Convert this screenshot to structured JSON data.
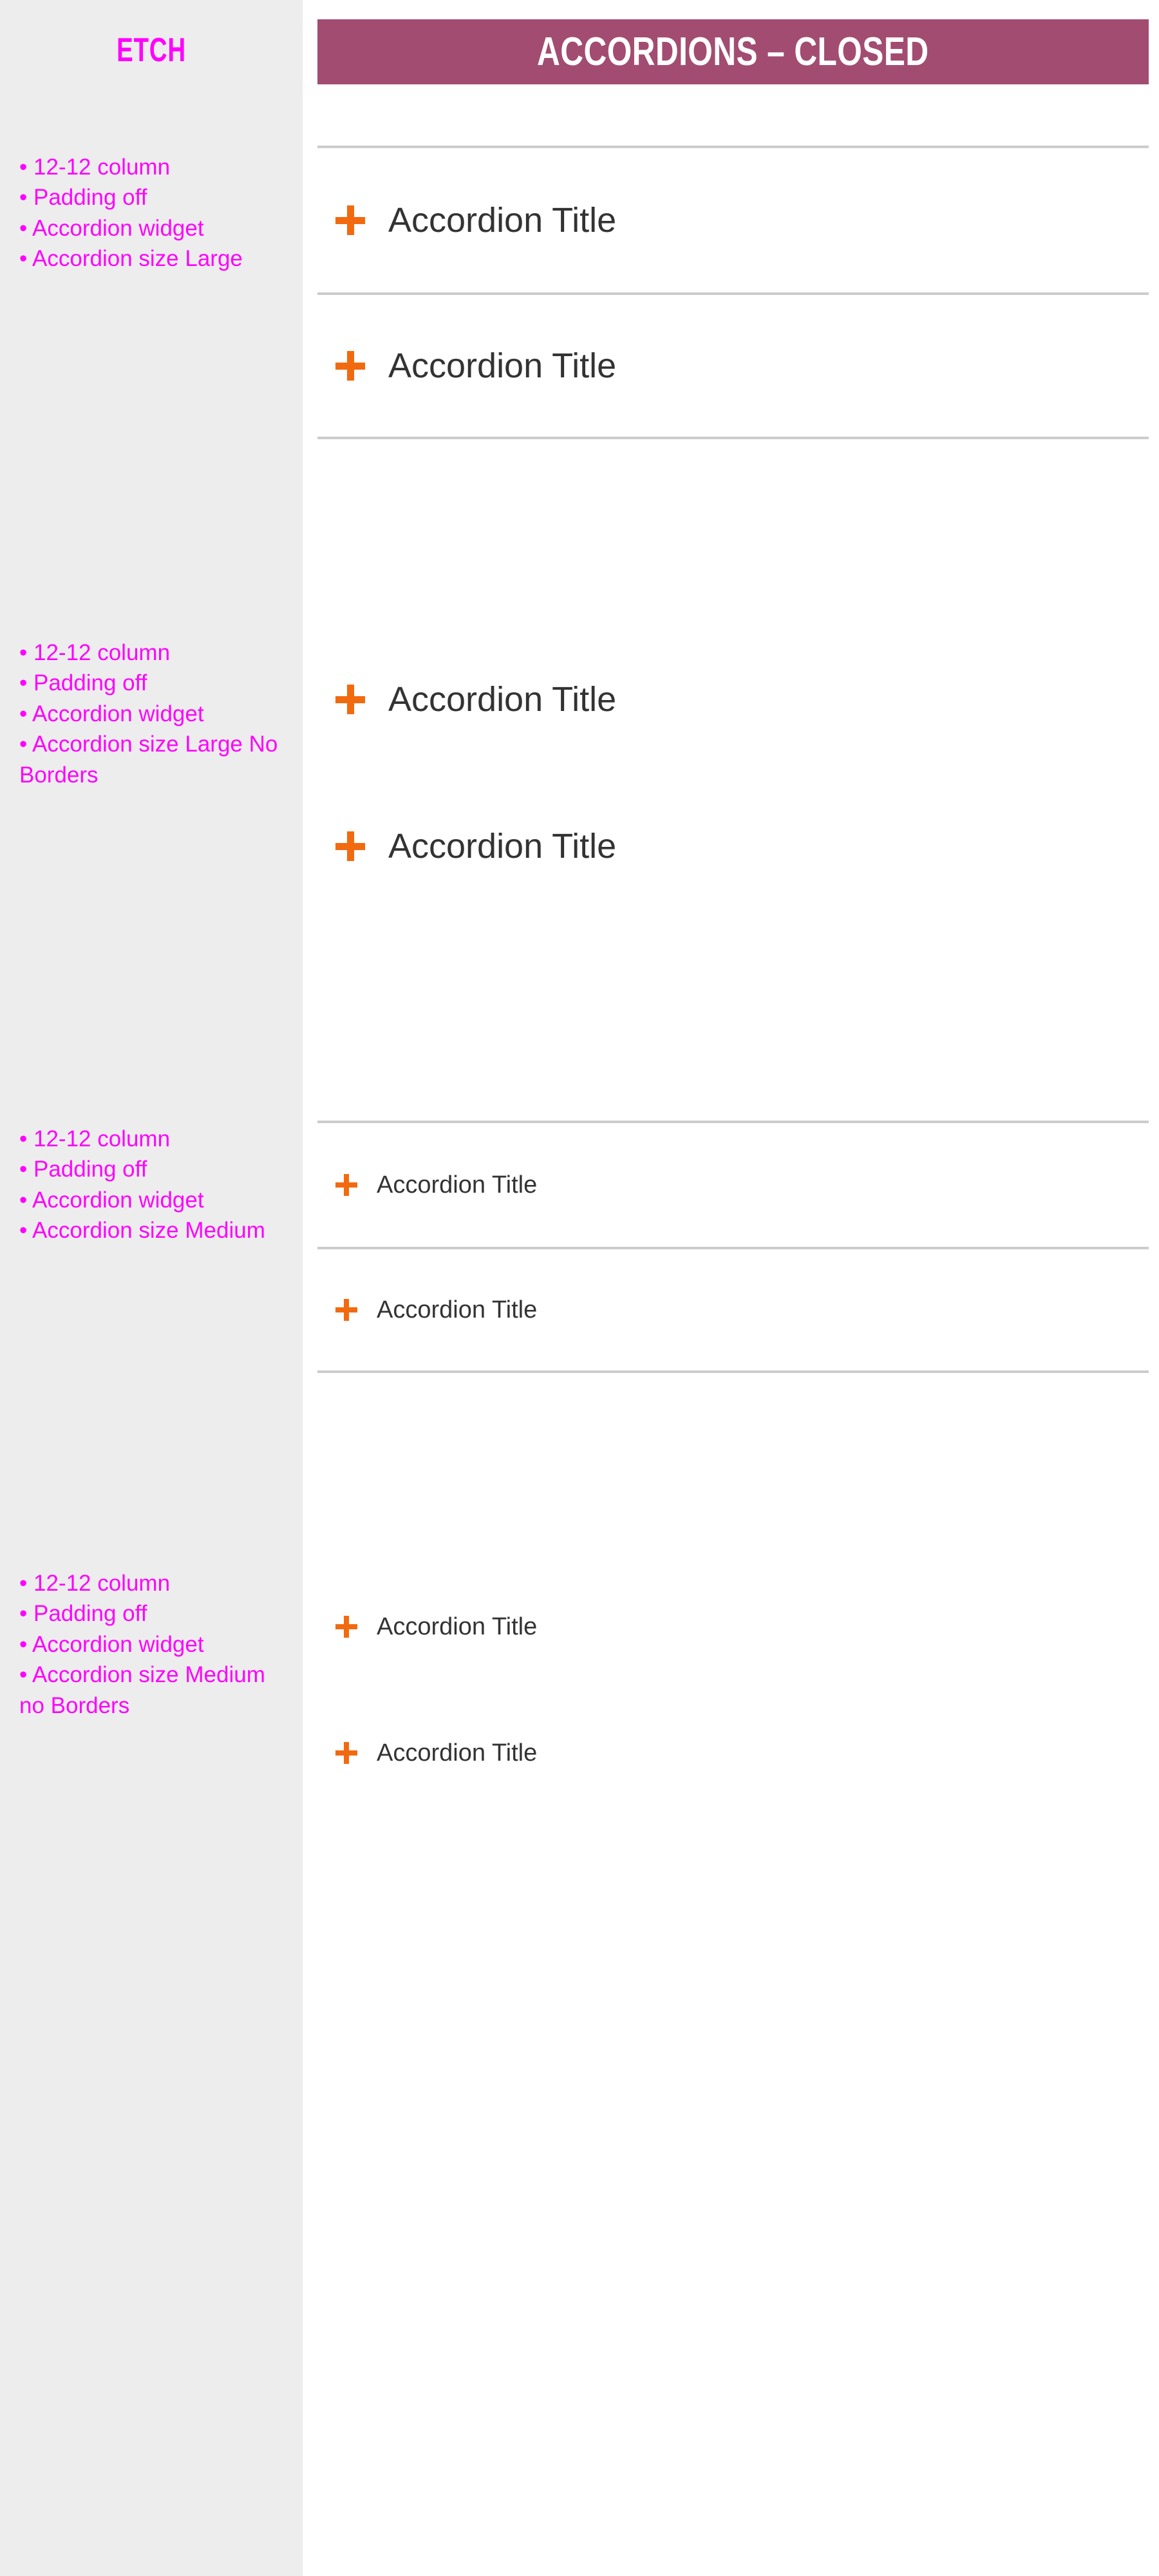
{
  "brand": {
    "name": "ETCH"
  },
  "banner": {
    "title": "ACCORDIONS – CLOSED",
    "background_color": "#a34c71",
    "text_color": "#ffffff"
  },
  "theme": {
    "sidebar_background": "#ededed",
    "annotation_color": "#ff00ff",
    "accent_orange": "#f26a10",
    "border_gray": "#cccccc",
    "title_color": "#333333",
    "page_background": "#ffffff"
  },
  "sidebar": {
    "blocks": [
      {
        "id": "notes-large",
        "lines": [
          "• 12-12 column",
          "• Padding off",
          "• Accordion widget",
          "• Accordion size Large"
        ]
      },
      {
        "id": "notes-large-no-borders",
        "lines": [
          "• 12-12 column",
          "• Padding off",
          "• Accordion widget",
          "• Accordion size Large No Borders"
        ]
      },
      {
        "id": "notes-medium",
        "lines": [
          "• 12-12 column",
          "• Padding off",
          "• Accordion widget",
          "• Accordion size Medium"
        ]
      },
      {
        "id": "notes-medium-no-borders",
        "lines": [
          "• 12-12 column",
          "• Padding off",
          "• Accordion widget",
          "• Accordion size Medium no Borders"
        ]
      }
    ]
  },
  "accordion_sections": [
    {
      "id": "section-large-bordered",
      "size": "Large",
      "borders": true,
      "items": [
        {
          "icon": "plus-icon",
          "title": "Accordion Title",
          "state": "closed"
        },
        {
          "icon": "plus-icon",
          "title": "Accordion Title",
          "state": "closed"
        }
      ]
    },
    {
      "id": "section-large-no-borders",
      "size": "Large",
      "borders": false,
      "items": [
        {
          "icon": "plus-icon",
          "title": "Accordion Title",
          "state": "closed"
        },
        {
          "icon": "plus-icon",
          "title": "Accordion Title",
          "state": "closed"
        }
      ]
    },
    {
      "id": "section-medium-bordered",
      "size": "Medium",
      "borders": true,
      "items": [
        {
          "icon": "plus-icon",
          "title": "Accordion Title",
          "state": "closed"
        },
        {
          "icon": "plus-icon",
          "title": "Accordion Title",
          "state": "closed"
        }
      ]
    },
    {
      "id": "section-medium-no-borders",
      "size": "Medium",
      "borders": false,
      "items": [
        {
          "icon": "plus-icon",
          "title": "Accordion Title",
          "state": "closed"
        },
        {
          "icon": "plus-icon",
          "title": "Accordion Title",
          "state": "closed"
        }
      ]
    }
  ]
}
